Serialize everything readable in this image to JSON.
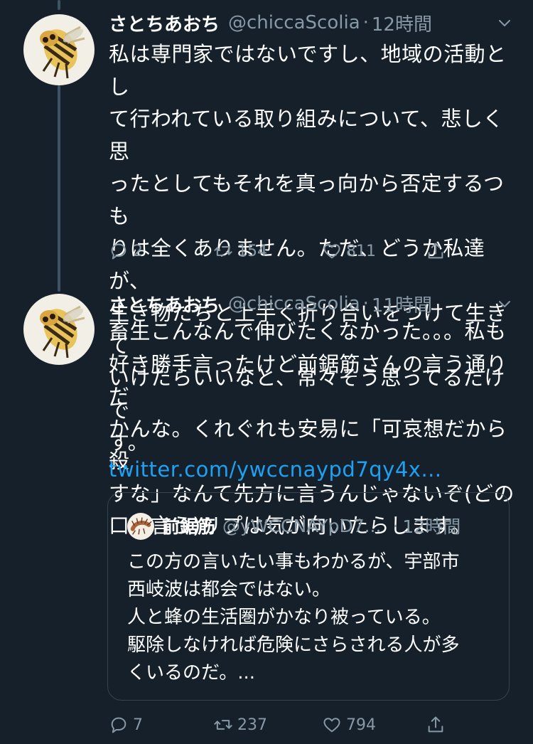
{
  "tweets": [
    {
      "name": "さとちあおち",
      "handle": "@chiccaScolia",
      "separator": "·",
      "time": "12時間",
      "body": "私は専門家ではないですし、地域の活動とし\nて行われている取り組みについて、悲しく思\nったとしてもそれを真っ向から否定するつも\nりは全くありません。ただ、どうか私達が、\n生き物たちと上手く折り合いをつけて生きて\nいけたらいいなと、常々そう思ってるだけで\nす。",
      "replies": "2",
      "retweets": "154",
      "likes": "811"
    },
    {
      "name": "さとちあおち",
      "handle": "@chiccaScolia",
      "separator": "·",
      "time": "11時間",
      "body": "畜生こんなんで伸びたくなかった。。。私も\n好き勝手言ったけど前鋸筋さんの言う通りだ\nかんな。くれぐれも安易に「可哀想だから殺\nすな」なんて先方に言うんじゃないぞ(どの\n口が言う)リプは気が向いたらします。",
      "link": "twitter.com/ywccnaypd7qy4x...",
      "quote": {
        "name": "前鋸筋",
        "handle": "@yWCCNAYpD7...",
        "separator": "·",
        "time": "12時間",
        "body": "この方の言いたい事もわかるが、宇部市\n西岐波は都会ではない。\n人と蜂の生活圏がかなり被っている。\n駆除しなければ危険にさらされる人が多\nくいるのだ。..."
      },
      "replies": "7",
      "retweets": "237",
      "likes": "794"
    }
  ],
  "icons": {
    "avatar": "hornet-avatar-icon",
    "reply": "reply-icon",
    "retweet": "retweet-icon",
    "like": "like-icon",
    "share": "share-icon",
    "menu": "chevron-down-icon"
  },
  "colors": {
    "background": "#15202b",
    "text": "#ffffff",
    "muted": "#8899a6",
    "link": "#1da1f2",
    "border": "#38444d",
    "thread_line": "#3d5466"
  }
}
